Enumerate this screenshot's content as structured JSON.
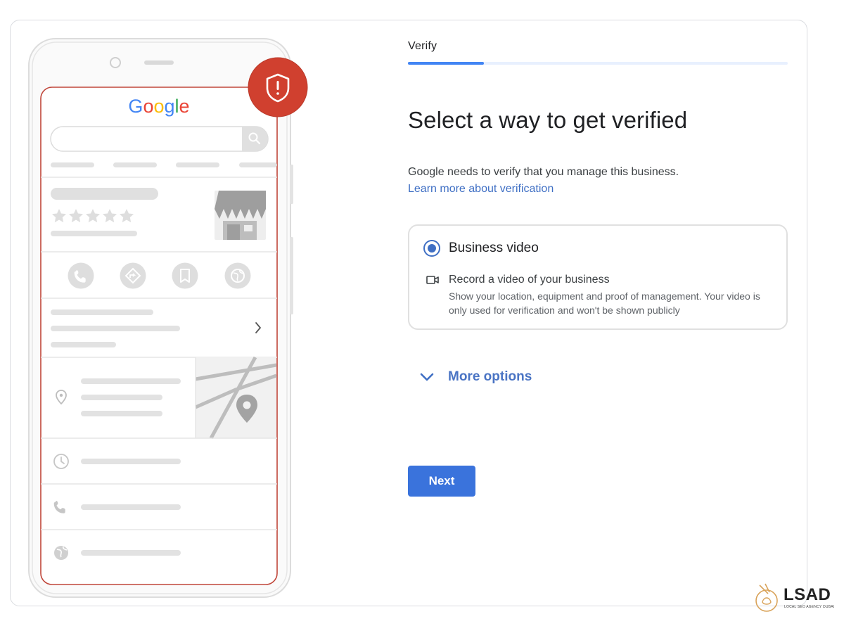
{
  "phone": {
    "brand_text": "Google",
    "rating_stars": 5,
    "colors": {
      "outline_red": "#c0463a",
      "shield_red": "#d0402f",
      "placeholder_gray": "#e2e2e2"
    },
    "action_icons": [
      "phone-icon",
      "directions-icon",
      "bookmark-icon",
      "globe-icon"
    ],
    "info_icons": [
      "location-pin-icon",
      "clock-icon",
      "phone-icon",
      "globe-icon"
    ],
    "badge_icon": "shield-alert-icon"
  },
  "stepper": {
    "label": "Verify",
    "progress": 0.2
  },
  "title": "Select a way to get verified",
  "description": "Google needs to verify that you manage this business.",
  "learn_more": "Learn more about verification",
  "option": {
    "selected": true,
    "title": "Business video",
    "icon": "video-camera-icon",
    "subtitle": "Record a video of your business",
    "help": "Show your location, equipment and proof of management. Your video is only used for verification and won't be shown publicly"
  },
  "more_options": {
    "label": "More options",
    "icon": "chevron-down-icon"
  },
  "next_button": "Next",
  "logo": {
    "text": "LSAD",
    "subtitle": "LOCAL SEO AGENCY DUBAI"
  },
  "colors": {
    "accent": "#3a73dc",
    "link": "#3f6fc4",
    "progress": "#4285f4",
    "border": "#dadce0"
  }
}
